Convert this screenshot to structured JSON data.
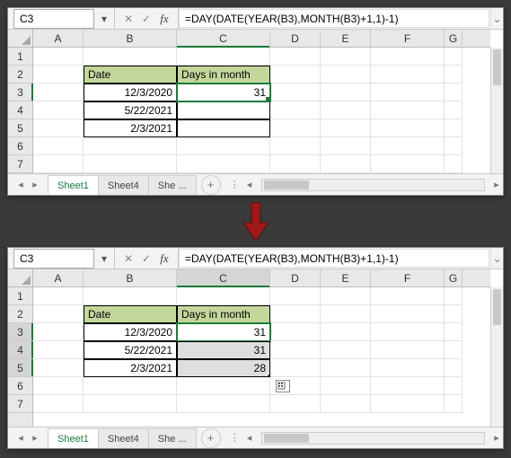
{
  "formula_bar": {
    "cell_ref": "C3",
    "formula": "=DAY(DATE(YEAR(B3),MONTH(B3)+1,1)-1)"
  },
  "columns": [
    "A",
    "B",
    "C",
    "D",
    "E",
    "F",
    "G"
  ],
  "top": {
    "rows": [
      "1",
      "2",
      "3",
      "4",
      "5",
      "6",
      "7"
    ],
    "headers": {
      "B": "Date",
      "C": "Days in month"
    },
    "data": [
      {
        "B": "12/3/2020",
        "C": "31"
      },
      {
        "B": "5/22/2021",
        "C": ""
      },
      {
        "B": "2/3/2021",
        "C": ""
      }
    ],
    "selection": {
      "col": "C",
      "row": "3"
    }
  },
  "bottom": {
    "rows": [
      "1",
      "2",
      "3",
      "4",
      "5",
      "6",
      "7"
    ],
    "headers": {
      "B": "Date",
      "C": "Days in month"
    },
    "data": [
      {
        "B": "12/3/2020",
        "C": "31"
      },
      {
        "B": "5/22/2021",
        "C": "31"
      },
      {
        "B": "2/3/2021",
        "C": "28"
      }
    ],
    "selection": {
      "col": "C",
      "row_start": "3",
      "row_end": "5"
    }
  },
  "tabs": {
    "items": [
      "Sheet1",
      "Sheet4",
      "She"
    ],
    "overflow": "...",
    "active": "Sheet1"
  },
  "chart_data": null
}
